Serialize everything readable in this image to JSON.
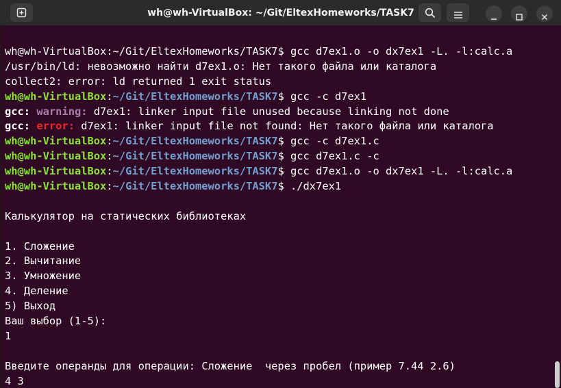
{
  "window": {
    "title": "wh@wh-VirtualBox: ~/Git/EltexHomeworks/TASK7",
    "icons": {
      "new_tab": "new-tab-icon",
      "search": "search-icon",
      "menu": "hamburger-menu-icon",
      "minimize": "minimize-icon",
      "maximize": "maximize-icon",
      "close": "close-icon"
    }
  },
  "colors": {
    "terminal_bg": "#300a24",
    "prompt_user": "#8ae234",
    "prompt_path": "#729fcf",
    "warning": "#ad7fa8",
    "error": "#ef2929"
  },
  "terminal": {
    "lines": [
      {
        "segs": [
          {
            "t": "wh@wh-VirtualBox:~/Git/EltexHomeworks/TASK7$ gcc d7ex1.o -o dx7ex1 -L. -l:calc.a",
            "c": ""
          }
        ]
      },
      {
        "segs": [
          {
            "t": "/usr/bin/ld: невозможно найти d7ex1.o: Нет такого файла или каталога",
            "c": ""
          }
        ]
      },
      {
        "segs": [
          {
            "t": "collect2: error: ld returned 1 exit status",
            "c": ""
          }
        ]
      },
      {
        "segs": [
          {
            "t": "wh@wh-VirtualBox",
            "c": "g"
          },
          {
            "t": ":",
            "c": ""
          },
          {
            "t": "~/Git/EltexHomeworks/TASK7",
            "c": "b"
          },
          {
            "t": "$ gcc -c d7ex1",
            "c": ""
          }
        ]
      },
      {
        "segs": [
          {
            "t": "gcc:",
            "c": "bold"
          },
          {
            "t": " ",
            "c": ""
          },
          {
            "t": "warning:",
            "c": "warn"
          },
          {
            "t": " d7ex1: linker input file unused because linking not done",
            "c": ""
          }
        ]
      },
      {
        "segs": [
          {
            "t": "gcc:",
            "c": "bold"
          },
          {
            "t": " ",
            "c": ""
          },
          {
            "t": "error:",
            "c": "err"
          },
          {
            "t": " d7ex1: linker input file not found: Нет такого файла или каталога",
            "c": ""
          }
        ]
      },
      {
        "segs": [
          {
            "t": "wh@wh-VirtualBox",
            "c": "g"
          },
          {
            "t": ":",
            "c": ""
          },
          {
            "t": "~/Git/EltexHomeworks/TASK7",
            "c": "b"
          },
          {
            "t": "$ gcc -c d7ex1.c",
            "c": ""
          }
        ]
      },
      {
        "segs": [
          {
            "t": "wh@wh-VirtualBox",
            "c": "g"
          },
          {
            "t": ":",
            "c": ""
          },
          {
            "t": "~/Git/EltexHomeworks/TASK7",
            "c": "b"
          },
          {
            "t": "$ gcc d7ex1.c -c",
            "c": ""
          }
        ]
      },
      {
        "segs": [
          {
            "t": "wh@wh-VirtualBox",
            "c": "g"
          },
          {
            "t": ":",
            "c": ""
          },
          {
            "t": "~/Git/EltexHomeworks/TASK7",
            "c": "b"
          },
          {
            "t": "$ gcc d7ex1.o -o dx7ex1 -L. -l:calc.a",
            "c": ""
          }
        ]
      },
      {
        "segs": [
          {
            "t": "wh@wh-VirtualBox",
            "c": "g"
          },
          {
            "t": ":",
            "c": ""
          },
          {
            "t": "~/Git/EltexHomeworks/TASK7",
            "c": "b"
          },
          {
            "t": "$ ./dx7ex1",
            "c": ""
          }
        ]
      },
      {
        "segs": [
          {
            "t": "",
            "c": ""
          }
        ]
      },
      {
        "segs": [
          {
            "t": "Калькулятор на статических библиотеках",
            "c": ""
          }
        ]
      },
      {
        "segs": [
          {
            "t": "",
            "c": ""
          }
        ]
      },
      {
        "segs": [
          {
            "t": "1. Сложение",
            "c": ""
          }
        ]
      },
      {
        "segs": [
          {
            "t": "2. Вычитание",
            "c": ""
          }
        ]
      },
      {
        "segs": [
          {
            "t": "3. Умножение",
            "c": ""
          }
        ]
      },
      {
        "segs": [
          {
            "t": "4. Деление",
            "c": ""
          }
        ]
      },
      {
        "segs": [
          {
            "t": "5) Выход",
            "c": ""
          }
        ]
      },
      {
        "segs": [
          {
            "t": "Ваш выбор (1-5):",
            "c": ""
          }
        ]
      },
      {
        "segs": [
          {
            "t": "1",
            "c": ""
          }
        ]
      },
      {
        "segs": [
          {
            "t": "",
            "c": ""
          }
        ]
      },
      {
        "segs": [
          {
            "t": "Введите операнды для операции: Сложение  через пробел (пример 7.44 2.6)",
            "c": ""
          }
        ]
      },
      {
        "segs": [
          {
            "t": "4 3",
            "c": ""
          }
        ]
      }
    ]
  }
}
